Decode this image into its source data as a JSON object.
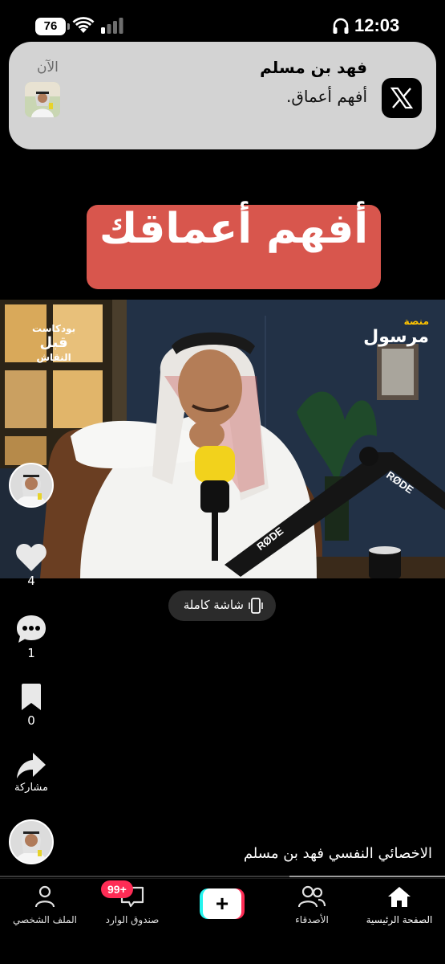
{
  "status_bar": {
    "battery": "76",
    "time": "12:03"
  },
  "notification": {
    "sender": "فهد بن مسلم",
    "message": "أفهم أعماق.",
    "time": "الآن",
    "app_icon": "x-logo-icon"
  },
  "headline": "أفهم أعماقك",
  "video": {
    "channel_logo_small": "منصة",
    "channel_logo_big": "مرسول",
    "podcast_line1": "بودكاست",
    "podcast_line2": "قبل",
    "podcast_line3": "النقاش",
    "mic_brand": "RØDE",
    "progress_fraction": 0.35
  },
  "fullscreen_label": "شاشة كاملة",
  "actions": {
    "likes": "4",
    "comments": "1",
    "saves": "0",
    "share_label": "مشاركة"
  },
  "caption": "الاخصائي النفسي  فهد بن مسلم",
  "nav": {
    "home": "الصفحة الرئيسية",
    "friends": "الأصدقاء",
    "create": "+",
    "inbox": "صندوق الوارد",
    "inbox_badge": "99+",
    "profile": "الملف الشخصي"
  }
}
